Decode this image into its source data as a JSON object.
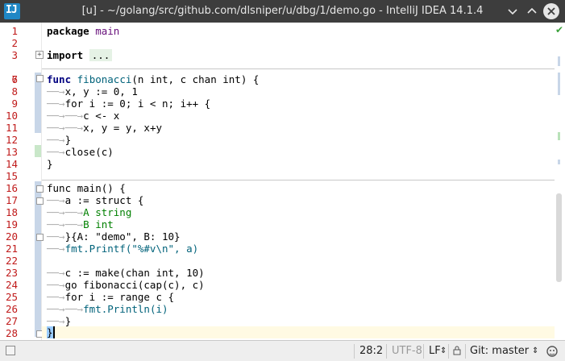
{
  "window": {
    "title": "[u] - ~/golang/src/github.com/dlsniper/u/dbg/1/demo.go - IntelliJ IDEA 14.1.4",
    "logo_text": "IJ",
    "controls": [
      "minimize",
      "maximize",
      "close"
    ]
  },
  "editor": {
    "line_numbers": [
      "1",
      "2",
      "3",
      "6",
      "7",
      "8",
      "9",
      "10",
      "11",
      "12",
      "13",
      "14",
      "15",
      "16",
      "17",
      "18",
      "19",
      "20",
      "21",
      "22",
      "23",
      "24",
      "25",
      "26",
      "27",
      "28"
    ],
    "lines": {
      "l1": {
        "kw": "package",
        "rest": " main"
      },
      "l3": {
        "kw": "import",
        "ph": "..."
      },
      "l7": {
        "kw": "func",
        "fn": "fibonacci",
        "params": "(n int, c chan int) {"
      },
      "l8": "x, y := 0, 1",
      "l9": "for i := 0; i < n; i++ {",
      "l10": "c <- x",
      "l11": "x, y = y, x+y",
      "l12": "}",
      "l13": "close(c)",
      "l14": "}",
      "l16": "func main() {",
      "l17": "a := struct {",
      "l18": "A string",
      "l19": "B int",
      "l20": "}{A: \"demo\", B: 10}",
      "l21": "fmt.Printf(\"%#v\\n\", a)",
      "l23": "c := make(chan int, 10)",
      "l24": "go fibonacci(cap(c), c)",
      "l25": "for i := range c {",
      "l26": "fmt.Println(i)",
      "l27": "}",
      "l28": "}"
    }
  },
  "status_bar": {
    "position": "28:2",
    "encoding": "UTF-8",
    "line_separator": "LF",
    "vcs_branch": "Git: master"
  }
}
